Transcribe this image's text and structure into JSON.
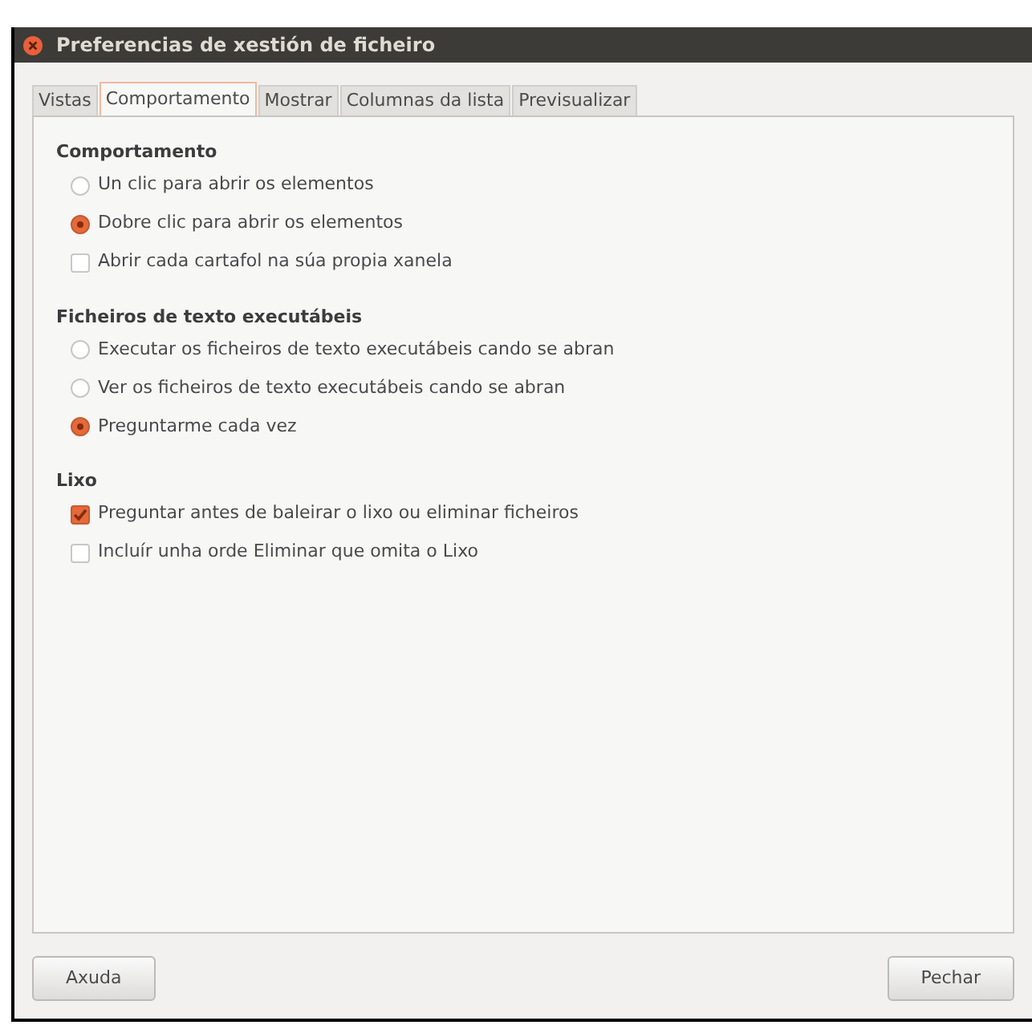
{
  "window": {
    "title": "Preferencias de xestión de ficheiro"
  },
  "tabs": [
    {
      "label": "Vistas",
      "selected": false
    },
    {
      "label": "Comportamento",
      "selected": true
    },
    {
      "label": "Mostrar",
      "selected": false
    },
    {
      "label": "Columnas da lista",
      "selected": false
    },
    {
      "label": "Previsualizar",
      "selected": false
    }
  ],
  "sections": [
    {
      "heading": "Comportamento",
      "options": [
        {
          "kind": "radio",
          "label": "Un clic para abrir os elementos",
          "selected": false
        },
        {
          "kind": "radio",
          "label": "Dobre clic para abrir os elementos",
          "selected": true
        },
        {
          "kind": "checkbox",
          "label": "Abrir cada cartafol na súa propia xanela",
          "checked": false
        }
      ]
    },
    {
      "heading": "Ficheiros de texto executábeis",
      "options": [
        {
          "kind": "radio",
          "label": "Executar os ficheiros de texto executábeis cando se abran",
          "selected": false
        },
        {
          "kind": "radio",
          "label": "Ver os ficheiros de texto executábeis cando se abran",
          "selected": false
        },
        {
          "kind": "radio",
          "label": "Preguntarme cada vez",
          "selected": true
        }
      ]
    },
    {
      "heading": "Lixo",
      "options": [
        {
          "kind": "checkbox",
          "label": "Preguntar antes de baleirar o lixo ou eliminar ficheiros",
          "checked": true
        },
        {
          "kind": "checkbox",
          "label": "Incluír unha orde Eliminar que omita o Lixo",
          "checked": false
        }
      ]
    }
  ],
  "buttons": [
    {
      "label": "Axuda"
    },
    {
      "label": "Pechar"
    }
  ]
}
